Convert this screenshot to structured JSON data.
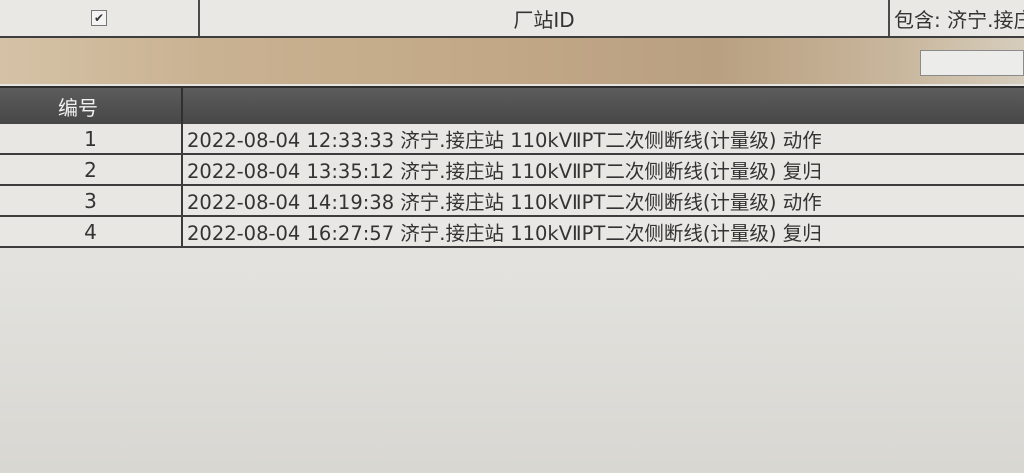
{
  "filter": {
    "checkbox_mark": "✔",
    "field_label": "厂站ID",
    "condition_text": "包含: 济宁.接庄"
  },
  "table": {
    "header_number": "编号",
    "rows": [
      {
        "num": "1",
        "text": "2022-08-04 12:33:33 济宁.接庄站 110kVⅡPT二次侧断线(计量级) 动作"
      },
      {
        "num": "2",
        "text": "2022-08-04 13:35:12 济宁.接庄站 110kVⅡPT二次侧断线(计量级) 复归"
      },
      {
        "num": "3",
        "text": "2022-08-04 14:19:38 济宁.接庄站 110kVⅡPT二次侧断线(计量级) 动作"
      },
      {
        "num": "4",
        "text": "2022-08-04 16:27:57 济宁.接庄站 110kVⅡPT二次侧断线(计量级) 复归"
      }
    ]
  },
  "colors": {
    "header_bg": "#4f4f4f",
    "row_bg": "#e8e7e3",
    "grid_line": "#3d3d3d"
  }
}
